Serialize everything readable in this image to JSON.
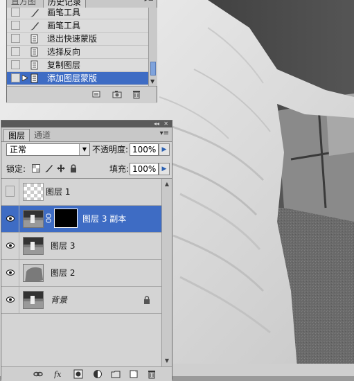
{
  "history_panel": {
    "tabs": [
      {
        "label": "直方图"
      },
      {
        "label": "历史记录"
      }
    ],
    "items": [
      {
        "label": "画笔工具",
        "icon": "brush-icon"
      },
      {
        "label": "画笔工具",
        "icon": "brush-icon"
      },
      {
        "label": "退出快速蒙版",
        "icon": "history-state-icon"
      },
      {
        "label": "选择反向",
        "icon": "history-state-icon"
      },
      {
        "label": "复制图层",
        "icon": "history-state-icon"
      },
      {
        "label": "添加图层蒙版",
        "icon": "history-state-icon",
        "selected": true
      }
    ],
    "footer_icons": [
      "new-document-from-state-icon",
      "snapshot-camera-icon",
      "trash-icon"
    ]
  },
  "layers_panel": {
    "tabs": [
      {
        "label": "图层"
      },
      {
        "label": "通道"
      }
    ],
    "blend_mode": "正常",
    "opacity_label": "不透明度:",
    "opacity_value": "100%",
    "lock_label": "锁定:",
    "fill_label": "填充:",
    "fill_value": "100%",
    "layers": [
      {
        "name": "图层 1",
        "visible": false,
        "thumb": "transparent"
      },
      {
        "name": "图层 3 副本",
        "visible": true,
        "thumb": "photo",
        "mask": true,
        "selected": true
      },
      {
        "name": "图层 3",
        "visible": true,
        "thumb": "photo"
      },
      {
        "name": "图层 2",
        "visible": true,
        "thumb": "gray-shape"
      },
      {
        "name": "背景",
        "visible": true,
        "thumb": "photo",
        "locked": true,
        "italic": true
      }
    ],
    "footer_icons": [
      "link-layers-icon",
      "fx-icon",
      "add-mask-icon",
      "adjustment-layer-icon",
      "group-folder-icon",
      "new-layer-icon",
      "trash-icon"
    ]
  },
  "colors": {
    "selection": "#3e6cc4",
    "panel_bg": "#d4d4d4"
  }
}
